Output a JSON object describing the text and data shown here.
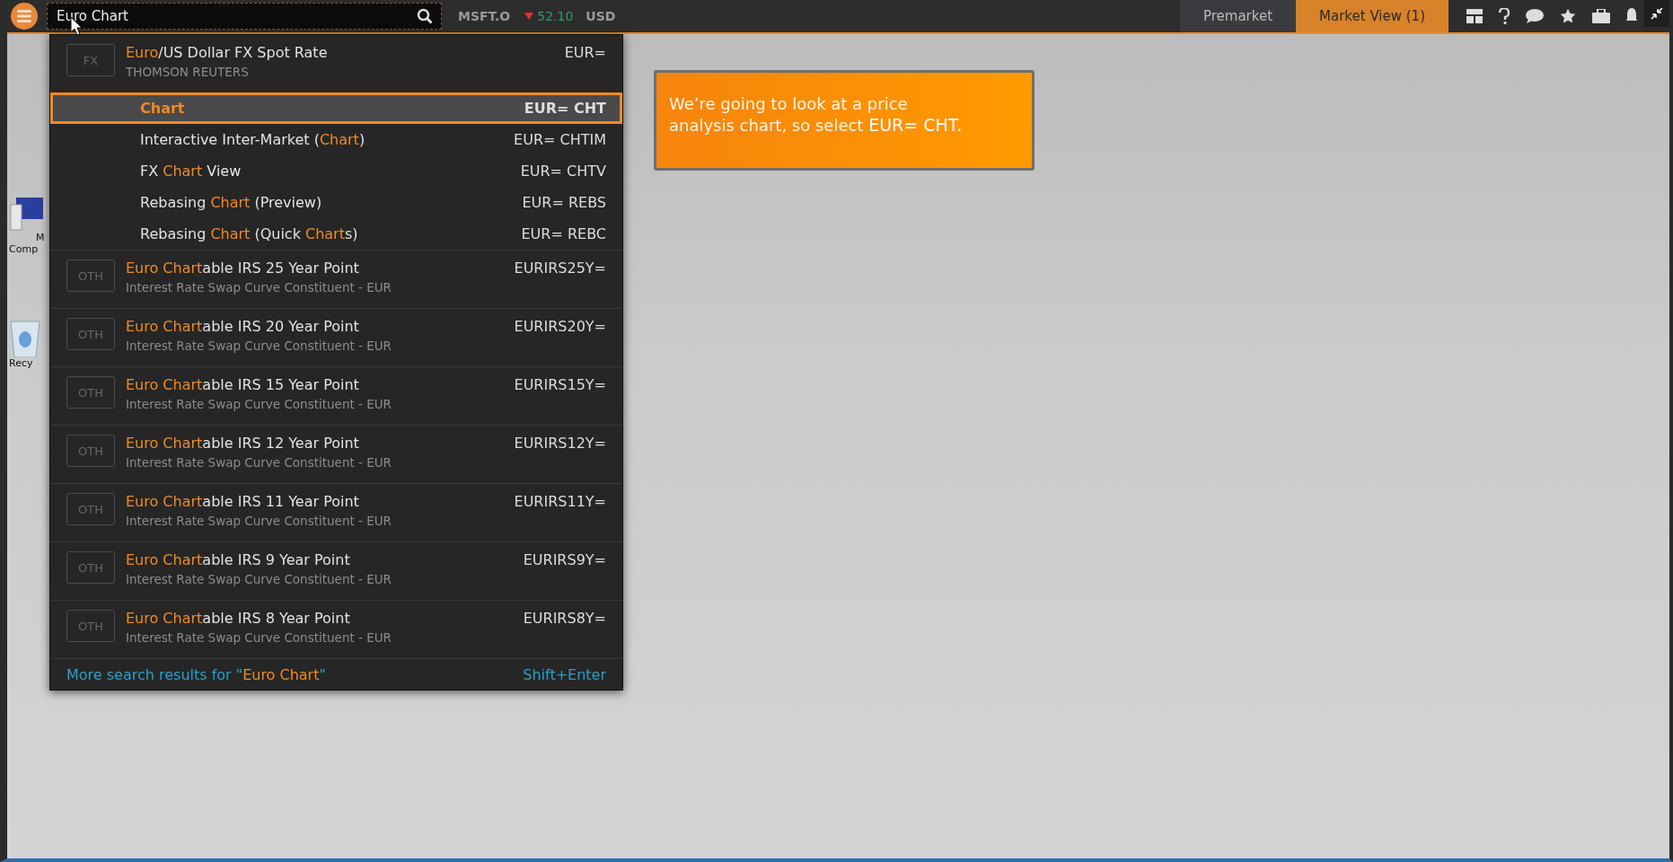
{
  "search": {
    "value": "Euro Chart"
  },
  "ticker": {
    "symbol": "MSFT.O",
    "falling": true,
    "price": "52.10",
    "currency": "USD"
  },
  "tabs": [
    {
      "label": "Premarket",
      "selected": false
    },
    {
      "label": "Market View (1)",
      "selected": true
    }
  ],
  "desktop_icons": [
    {
      "kind": "computer",
      "labels": [
        "M",
        "Comp"
      ]
    },
    {
      "kind": "recycle",
      "labels": [
        "Recy"
      ]
    }
  ],
  "results": [
    {
      "badge": "FX",
      "title": [
        {
          "text": "Euro",
          "match": true
        },
        {
          "text": "/US Dollar FX Spot Rate",
          "match": false
        }
      ],
      "subtitle": "THOMSON REUTERS",
      "code": "EUR=",
      "children": [
        {
          "title": [
            {
              "text": "Chart",
              "match": true
            }
          ],
          "code": "EUR= CHT",
          "selected": true
        },
        {
          "title": [
            {
              "text": "Interactive Inter-Market (",
              "match": false
            },
            {
              "text": "Chart",
              "match": true
            },
            {
              "text": ")",
              "match": false
            }
          ],
          "code": "EUR= CHTIM",
          "selected": false
        },
        {
          "title": [
            {
              "text": "FX ",
              "match": false
            },
            {
              "text": "Chart",
              "match": true
            },
            {
              "text": " View",
              "match": false
            }
          ],
          "code": "EUR= CHTV",
          "selected": false
        },
        {
          "title": [
            {
              "text": "Rebasing ",
              "match": false
            },
            {
              "text": "Chart",
              "match": true
            },
            {
              "text": " (Preview)",
              "match": false
            }
          ],
          "code": "EUR= REBS",
          "selected": false
        },
        {
          "title": [
            {
              "text": "Rebasing ",
              "match": false
            },
            {
              "text": "Chart",
              "match": true
            },
            {
              "text": " (Quick ",
              "match": false
            },
            {
              "text": "Chart",
              "match": true
            },
            {
              "text": "s)",
              "match": false
            }
          ],
          "code": "EUR= REBC",
          "selected": false
        }
      ]
    },
    {
      "badge": "OTH",
      "title": [
        {
          "text": "Euro Chart",
          "match": true
        },
        {
          "text": "able IRS 25 Year Point",
          "match": false
        }
      ],
      "subtitle": "Interest Rate Swap Curve Constituent - EUR",
      "code": "EURIRS25Y="
    },
    {
      "badge": "OTH",
      "title": [
        {
          "text": "Euro Chart",
          "match": true
        },
        {
          "text": "able IRS 20 Year Point",
          "match": false
        }
      ],
      "subtitle": "Interest Rate Swap Curve Constituent - EUR",
      "code": "EURIRS20Y="
    },
    {
      "badge": "OTH",
      "title": [
        {
          "text": "Euro Chart",
          "match": true
        },
        {
          "text": "able IRS 15 Year Point",
          "match": false
        }
      ],
      "subtitle": "Interest Rate Swap Curve Constituent - EUR",
      "code": "EURIRS15Y="
    },
    {
      "badge": "OTH",
      "title": [
        {
          "text": "Euro Chart",
          "match": true
        },
        {
          "text": "able IRS 12 Year Point",
          "match": false
        }
      ],
      "subtitle": "Interest Rate Swap Curve Constituent - EUR",
      "code": "EURIRS12Y="
    },
    {
      "badge": "OTH",
      "title": [
        {
          "text": "Euro Chart",
          "match": true
        },
        {
          "text": "able IRS 11 Year Point",
          "match": false
        }
      ],
      "subtitle": "Interest Rate Swap Curve Constituent - EUR",
      "code": "EURIRS11Y="
    },
    {
      "badge": "OTH",
      "title": [
        {
          "text": "Euro Chart",
          "match": true
        },
        {
          "text": "able IRS 9 Year Point",
          "match": false
        }
      ],
      "subtitle": "Interest Rate Swap Curve Constituent - EUR",
      "code": "EURIRS9Y="
    },
    {
      "badge": "OTH",
      "title": [
        {
          "text": "Euro Chart",
          "match": true
        },
        {
          "text": "able IRS 8 Year Point",
          "match": false
        }
      ],
      "subtitle": "Interest Rate Swap Curve Constituent - EUR",
      "code": "EURIRS8Y="
    }
  ],
  "more_results": {
    "text": [
      {
        "text": "More search results for \"",
        "match": false
      },
      {
        "text": "Euro Chart",
        "match": true
      },
      {
        "text": "\"",
        "match": false
      }
    ],
    "shortcut": "Shift+Enter"
  },
  "callout": {
    "lines": [
      "We’re going to look at a price",
      "analysis chart, so select "
    ],
    "highlight": "EUR= CHT."
  }
}
